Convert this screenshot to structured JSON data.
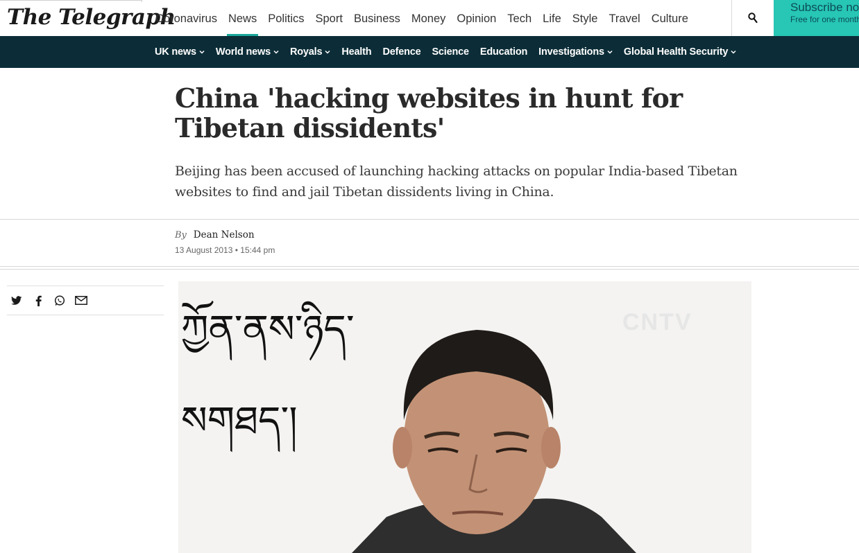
{
  "brand": {
    "logo_text": "The Telegraph"
  },
  "main_nav": [
    {
      "label": "Coronavirus",
      "active": false
    },
    {
      "label": "News",
      "active": true
    },
    {
      "label": "Politics",
      "active": false
    },
    {
      "label": "Sport",
      "active": false
    },
    {
      "label": "Business",
      "active": false
    },
    {
      "label": "Money",
      "active": false
    },
    {
      "label": "Opinion",
      "active": false
    },
    {
      "label": "Tech",
      "active": false
    },
    {
      "label": "Life",
      "active": false
    },
    {
      "label": "Style",
      "active": false
    },
    {
      "label": "Travel",
      "active": false
    },
    {
      "label": "Culture",
      "active": false
    }
  ],
  "subscribe": {
    "title": "Subscribe now",
    "subtitle": "Free for one month"
  },
  "section_nav": [
    {
      "label": "UK news",
      "dropdown": true
    },
    {
      "label": "World news",
      "dropdown": true
    },
    {
      "label": "Royals",
      "dropdown": true
    },
    {
      "label": "Health",
      "dropdown": false
    },
    {
      "label": "Defence",
      "dropdown": false
    },
    {
      "label": "Science",
      "dropdown": false
    },
    {
      "label": "Education",
      "dropdown": false
    },
    {
      "label": "Investigations",
      "dropdown": true
    },
    {
      "label": "Global Health Security",
      "dropdown": true
    }
  ],
  "article": {
    "headline": "China 'hacking websites in hunt for Tibetan dissidents'",
    "standfirst": "Beijing has been accused of launching hacking attacks on popular India-based Tibetan websites to find and jail Tibetan dissidents living in China.",
    "by_label": "By",
    "author": "Dean Nelson",
    "date": "13 August 2013 • 15:44 pm"
  },
  "share_icons": [
    "twitter-icon",
    "facebook-icon",
    "whatsapp-icon",
    "email-icon"
  ],
  "photo": {
    "caption_line1": "ཀྱོན་ནས་ཉིད་",
    "caption_line2": "སགཐད་།",
    "watermark": "CNTV"
  },
  "colors": {
    "accent": "#1aa99b",
    "section_nav_bg": "#0c2d37",
    "subscribe_bg": "#27c6b5"
  }
}
